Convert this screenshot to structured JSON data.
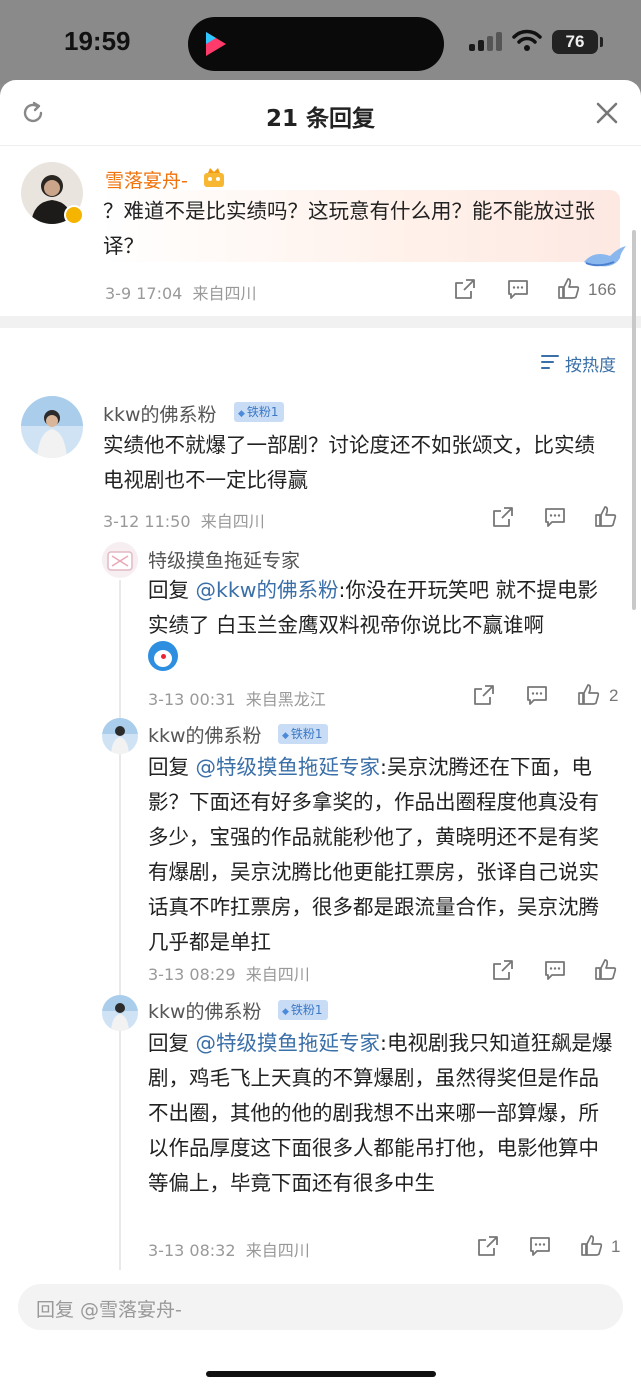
{
  "status": {
    "time": "19:59",
    "battery": "76"
  },
  "header": {
    "title": "21 条回复"
  },
  "root_comment": {
    "user": "雪落宴舟-",
    "text": "？难道不是比实绩吗？这玩意有什么用？能不能放过张译？",
    "time": "3-9 17:04",
    "location": "来自四川",
    "likes": "166"
  },
  "sort_label": "按热度",
  "comments": [
    {
      "user": "kkw的佛系粉",
      "badge": "铁粉1",
      "text": "实绩他不就爆了一部剧？讨论度还不如张颂文，比实绩电视剧也不一定比得赢",
      "time": "3-12 11:50",
      "location": "来自四川",
      "likes": ""
    },
    {
      "user": "特级摸鱼拖延专家",
      "reply_prefix": "回复",
      "mention": "@kkw的佛系粉",
      "text": ":你没在开玩笑吧 就不提电影实绩了 白玉兰金鹰双料视帝你说比不赢谁啊",
      "time": "3-13 00:31",
      "location": "来自黑龙江",
      "likes": "2"
    },
    {
      "user": "kkw的佛系粉",
      "badge": "铁粉1",
      "reply_prefix": "回复",
      "mention": "@特级摸鱼拖延专家",
      "text": ":吴京沈腾还在下面，电影？下面还有好多拿奖的，作品出圈程度他真没有多少，宝强的作品就能秒他了，黄晓明还不是有奖有爆剧，吴京沈腾比他更能扛票房，张译自己说实话真不咋扛票房，很多都是跟流量合作，吴京沈腾几乎都是单扛",
      "time": "3-13 08:29",
      "location": "来自四川",
      "likes": ""
    },
    {
      "user": "kkw的佛系粉",
      "badge": "铁粉1",
      "reply_prefix": "回复",
      "mention": "@特级摸鱼拖延专家",
      "text": ":电视剧我只知道狂飙是爆剧，鸡毛飞上天真的不算爆剧，虽然得奖但是作品不出圈，其他的他的剧我想不出来哪一部算爆，所以作品厚度这下面很多人都能吊打他，电影他算中等偏上，毕竟下面还有很多中生",
      "time": "3-13 08:32",
      "location": "来自四川",
      "likes": "1"
    }
  ],
  "reply_input": {
    "placeholder": "回复 @雪落宴舟-"
  },
  "colors": {
    "link": "#3a6fa8",
    "username_vip": "#f0730c",
    "badge_bg": "#c9dcf6"
  },
  "icons": [
    "refresh-icon",
    "close-icon",
    "share-icon",
    "comment-icon",
    "like-icon",
    "sort-icon",
    "verified-icon",
    "crown-icon"
  ]
}
